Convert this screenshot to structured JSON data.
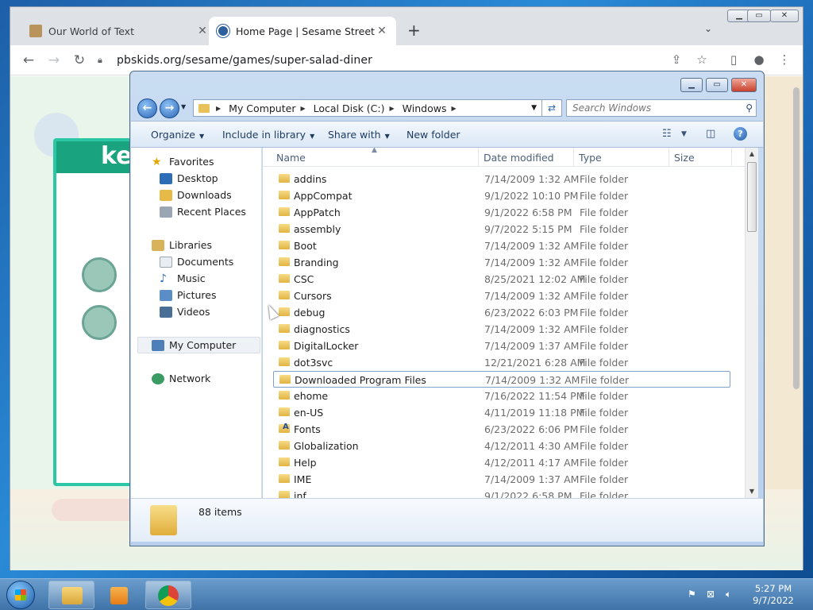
{
  "browser": {
    "tabs": [
      {
        "title": "Our World of Text",
        "active": false
      },
      {
        "title": "Home Page | Sesame Street | PBS",
        "active": true
      }
    ],
    "url": "pbskids.org/sesame/games/super-salad-diner",
    "page_banner_fragment": "ke"
  },
  "explorer": {
    "breadcrumb": [
      "My Computer",
      "Local Disk (C:)",
      "Windows"
    ],
    "search_placeholder": "Search Windows",
    "commands": {
      "organize": "Organize",
      "include_in_library": "Include in library",
      "share_with": "Share with",
      "new_folder": "New folder"
    },
    "nav": {
      "favorites": "Favorites",
      "desktop": "Desktop",
      "downloads": "Downloads",
      "recent_places": "Recent Places",
      "libraries": "Libraries",
      "documents": "Documents",
      "music": "Music",
      "pictures": "Pictures",
      "videos": "Videos",
      "my_computer": "My Computer",
      "network": "Network"
    },
    "columns": {
      "name": "Name",
      "date_modified": "Date modified",
      "type": "Type",
      "size": "Size"
    },
    "files": [
      {
        "name": "addins",
        "date": "7/14/2009 1:32 AM",
        "type": "File folder"
      },
      {
        "name": "AppCompat",
        "date": "9/1/2022 10:10 PM",
        "type": "File folder"
      },
      {
        "name": "AppPatch",
        "date": "9/1/2022 6:58 PM",
        "type": "File folder"
      },
      {
        "name": "assembly",
        "date": "9/7/2022 5:15 PM",
        "type": "File folder"
      },
      {
        "name": "Boot",
        "date": "7/14/2009 1:32 AM",
        "type": "File folder"
      },
      {
        "name": "Branding",
        "date": "7/14/2009 1:32 AM",
        "type": "File folder"
      },
      {
        "name": "CSC",
        "date": "8/25/2021 12:02 AM",
        "type": "File folder"
      },
      {
        "name": "Cursors",
        "date": "7/14/2009 1:32 AM",
        "type": "File folder"
      },
      {
        "name": "debug",
        "date": "6/23/2022 6:03 PM",
        "type": "File folder"
      },
      {
        "name": "diagnostics",
        "date": "7/14/2009 1:32 AM",
        "type": "File folder"
      },
      {
        "name": "DigitalLocker",
        "date": "7/14/2009 1:37 AM",
        "type": "File folder"
      },
      {
        "name": "dot3svc",
        "date": "12/21/2021 6:28 AM",
        "type": "File folder"
      },
      {
        "name": "Downloaded Program Files",
        "date": "7/14/2009 1:32 AM",
        "type": "File folder"
      },
      {
        "name": "ehome",
        "date": "7/16/2022 11:54 PM",
        "type": "File folder"
      },
      {
        "name": "en-US",
        "date": "4/11/2019 11:18 PM",
        "type": "File folder"
      },
      {
        "name": "Fonts",
        "date": "6/23/2022 6:06 PM",
        "type": "File folder"
      },
      {
        "name": "Globalization",
        "date": "4/12/2011 4:30 AM",
        "type": "File folder"
      },
      {
        "name": "Help",
        "date": "4/12/2011 4:17 AM",
        "type": "File folder"
      },
      {
        "name": "IME",
        "date": "7/14/2009 1:37 AM",
        "type": "File folder"
      },
      {
        "name": "inf",
        "date": "9/1/2022 6:58 PM",
        "type": "File folder"
      }
    ],
    "item_count": "88 items"
  },
  "taskbar": {
    "time": "5:27 PM",
    "date": "9/7/2022"
  }
}
